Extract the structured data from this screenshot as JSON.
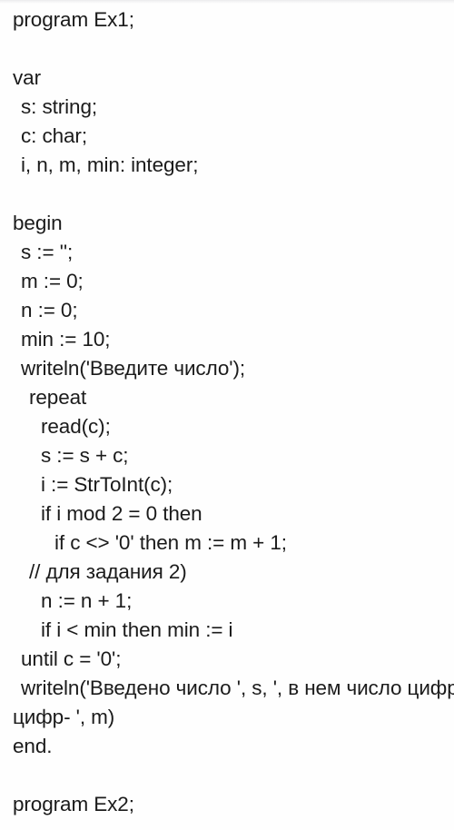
{
  "document": {
    "kind": "pascal-source-listing",
    "language_hint": "Pascal",
    "text_color": "#1b1b1b",
    "background_color": "#fefefe"
  },
  "listing": {
    "lines": [
      {
        "text": "program Ex1;",
        "indent": 0,
        "clipped": false
      },
      {
        "text": "",
        "indent": 0,
        "clipped": false
      },
      {
        "text": "var",
        "indent": 0,
        "clipped": false
      },
      {
        "text": "s: string;",
        "indent": 1,
        "clipped": false
      },
      {
        "text": "c: char;",
        "indent": 1,
        "clipped": false
      },
      {
        "text": "i, n, m, min: integer;",
        "indent": 1,
        "clipped": false
      },
      {
        "text": "",
        "indent": 0,
        "clipped": false
      },
      {
        "text": "begin",
        "indent": 0,
        "clipped": false
      },
      {
        "text": "s := '';",
        "indent": 1,
        "clipped": false
      },
      {
        "text": "m := 0;",
        "indent": 1,
        "clipped": false
      },
      {
        "text": "n := 0;",
        "indent": 1,
        "clipped": false
      },
      {
        "text": "min := 10;",
        "indent": 1,
        "clipped": false
      },
      {
        "text": "writeln('Введите число');",
        "indent": 1,
        "clipped": false
      },
      {
        "text": "repeat",
        "indent": 2,
        "clipped": false
      },
      {
        "text": "read(c);",
        "indent": 3,
        "clipped": false
      },
      {
        "text": "s := s + c;",
        "indent": 3,
        "clipped": false
      },
      {
        "text": "i := StrToInt(c);",
        "indent": 3,
        "clipped": false
      },
      {
        "text": "if i mod 2 = 0 then",
        "indent": 3,
        "clipped": false
      },
      {
        "text": "if c <> '0' then m := m + 1;",
        "indent": 4,
        "clipped": false
      },
      {
        "text": "// для задания 2)",
        "indent": 2,
        "clipped": false
      },
      {
        "text": "n := n + 1;",
        "indent": 3,
        "clipped": false
      },
      {
        "text": "if i < min then min := i",
        "indent": 3,
        "clipped": false
      },
      {
        "text": "until c = '0';",
        "indent": 1,
        "clipped": false
      },
      {
        "text": "writeln('Введено число ', s, ', в нем число цифр- ', m)",
        "indent": 1,
        "clipped": true
      },
      {
        "text": "цифр- ', m)",
        "indent": 0,
        "clipped": false
      },
      {
        "text": "end.",
        "indent": 0,
        "clipped": false
      },
      {
        "text": "",
        "indent": 0,
        "clipped": false
      },
      {
        "text": "program Ex2;",
        "indent": 0,
        "clipped": false
      }
    ]
  }
}
